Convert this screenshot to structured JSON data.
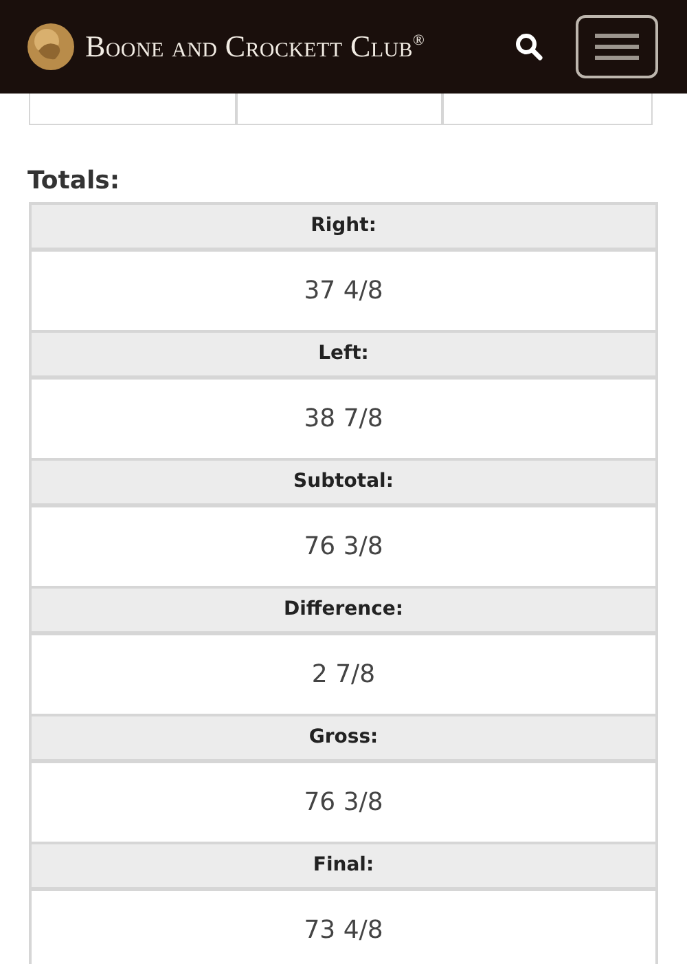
{
  "header": {
    "title": "Boone and Crockett Club$^{®}$"
  },
  "totals": {
    "heading": "Totals:",
    "rows": [
      {
        "label": "Right:",
        "value": "37 4/8"
      },
      {
        "label": "Left:",
        "value": "38 7/8"
      },
      {
        "label": "Subtotal:",
        "value": "76 3/8"
      },
      {
        "label": "Difference:",
        "value": "2 7/8"
      },
      {
        "label": "Gross:",
        "value": "76 3/8"
      },
      {
        "label": "Final:",
        "value": "73 4/8"
      }
    ]
  }
}
